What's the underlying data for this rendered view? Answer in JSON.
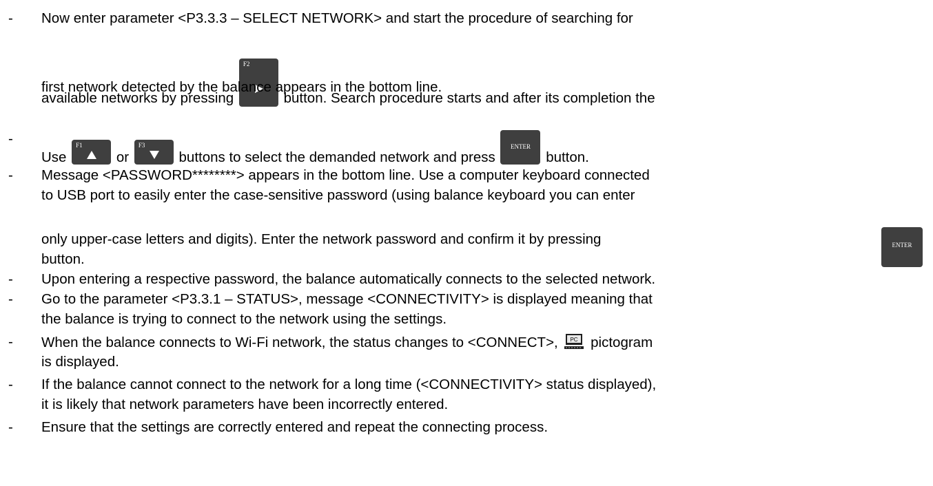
{
  "bullet": "-",
  "items": [
    {
      "line1": "Now enter parameter <P3.3.3 – SELECT NETWORK> and start the procedure of searching for",
      "line2a": "available networks by pressing",
      "line2b": "button. Search procedure starts and after its completion the",
      "line3": "first network detected by the balance appears in the bottom line."
    },
    {
      "a": "Use",
      "b": "or",
      "c": "buttons to select the demanded network and press",
      "d": "button."
    },
    {
      "line1": "Message <PASSWORD********> appears in the bottom line. Use a computer keyboard connected",
      "line2": "to USB port to easily enter the case-sensitive password (using balance keyboard you can enter",
      "line3": "only upper-case letters and digits). Enter the network password and confirm it by pressing",
      "line4": "button."
    },
    {
      "line1": "Upon entering a respective password, the balance automatically connects to the selected network."
    },
    {
      "line1": "Go to the parameter <P3.3.1 – STATUS>, message <CONNECTIVITY> is displayed meaning that",
      "line2": "the balance is trying to connect to the network using the settings."
    },
    {
      "line1a": "When the balance connects to Wi-Fi network, the status changes to <CONNECT>,",
      "line1b": "pictogram",
      "line2": "is displayed."
    },
    {
      "line1": "If the balance cannot connect to the network for a long time (<CONNECTIVITY> status displayed),",
      "line2": "it is likely that network parameters have been incorrectly entered."
    },
    {
      "line1": "Ensure that the settings are correctly entered and repeat the connecting process."
    }
  ],
  "keys": {
    "f2": "F2",
    "f1": "F1",
    "f3": "F3",
    "enter": "ENTER",
    "pc": "PC"
  },
  "icons": {
    "f2_key": "right-arrow-icon",
    "f1_key": "up-arrow-icon",
    "f3_key": "down-arrow-icon",
    "pc_pictogram": "pc-icon"
  }
}
